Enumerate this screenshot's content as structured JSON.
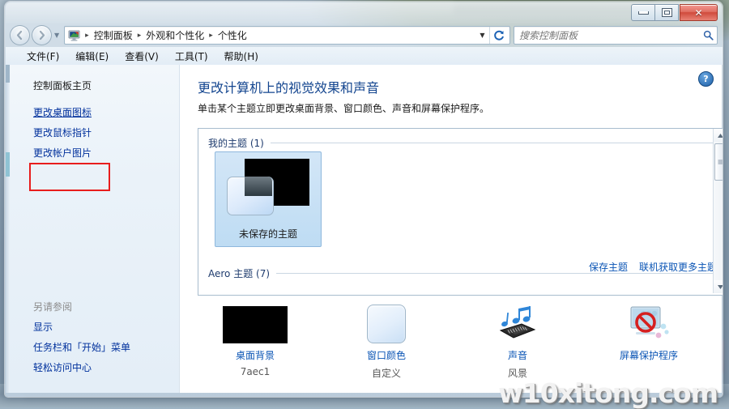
{
  "window": {
    "controls": {
      "minimize": "–",
      "maximize": "□",
      "close": "✕"
    }
  },
  "nav": {
    "back_tooltip": "后退",
    "forward_tooltip": "前进",
    "breadcrumb": [
      "控制面板",
      "外观和个性化",
      "个性化"
    ],
    "separator": "▸",
    "refresh_label": "刷新"
  },
  "search": {
    "placeholder": "搜索控制面板",
    "value": ""
  },
  "menubar": {
    "items": [
      "文件(F)",
      "编辑(E)",
      "查看(V)",
      "工具(T)",
      "帮助(H)"
    ]
  },
  "sidebar": {
    "home": "控制面板主页",
    "items": [
      "更改桌面图标",
      "更改鼠标指针",
      "更改帐户图片"
    ],
    "highlighted_item": "更改桌面图标",
    "see_also_header": "另请参阅",
    "see_also": [
      "显示",
      "任务栏和「开始」菜单",
      "轻松访问中心"
    ]
  },
  "main": {
    "title": "更改计算机上的视觉效果和声音",
    "subtitle": "单击某个主题立即更改桌面背景、窗口颜色、声音和屏幕保护程序。",
    "help_icon": "?",
    "groups": [
      {
        "label": "我的主题 (1)"
      },
      {
        "label": "Aero 主题 (7)"
      }
    ],
    "themes": [
      {
        "name": "未保存的主题",
        "selected": true
      }
    ],
    "theme_links": [
      "保存主题",
      "联机获取更多主题"
    ],
    "settings": [
      {
        "label": "桌面背景",
        "value": "7aec1",
        "icon": "wallpaper-icon"
      },
      {
        "label": "窗口颜色",
        "value": "自定义",
        "icon": "window-color-icon"
      },
      {
        "label": "声音",
        "value": "风景",
        "icon": "sound-icon"
      },
      {
        "label": "屏幕保护程序",
        "value": "",
        "icon": "screensaver-icon"
      }
    ]
  },
  "watermark": {
    "text": "w10xitong.com"
  },
  "colors": {
    "link": "#0b55b5",
    "sidebar_link": "#00309c",
    "title": "#13458f",
    "highlight_box": "#e81d1d",
    "selection": "#bedcf3"
  }
}
